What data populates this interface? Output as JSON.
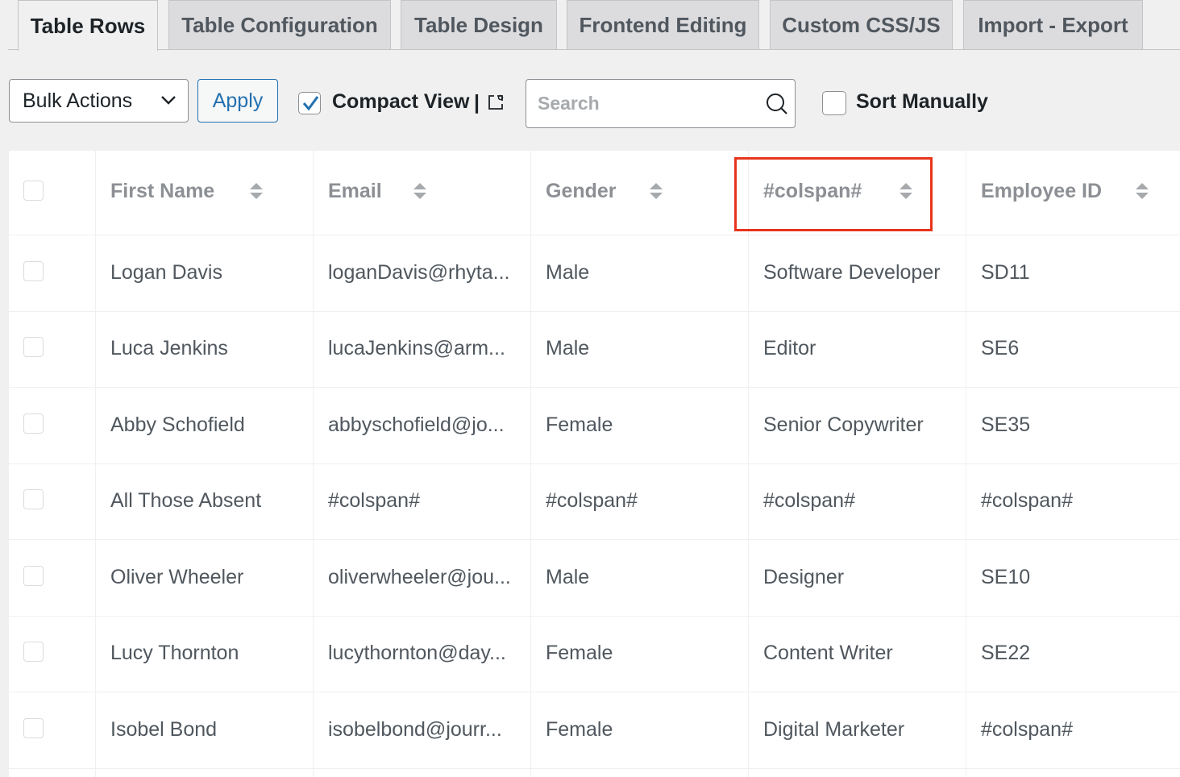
{
  "tabs": [
    {
      "label": "Table Rows",
      "active": true
    },
    {
      "label": "Table Configuration",
      "active": false
    },
    {
      "label": "Table Design",
      "active": false
    },
    {
      "label": "Frontend Editing",
      "active": false
    },
    {
      "label": "Custom CSS/JS",
      "active": false
    },
    {
      "label": "Import - Export",
      "active": false
    }
  ],
  "toolbar": {
    "bulk_actions": "Bulk Actions",
    "apply": "Apply",
    "compact_view": "Compact View",
    "separator": "|",
    "compact_view_checked": true,
    "search_placeholder": "Search",
    "search_value": "",
    "sort_manually": "Sort Manually",
    "sort_manually_checked": false
  },
  "table": {
    "columns": [
      "First Name",
      "Email",
      "Gender",
      "#colspan#",
      "Employee ID"
    ],
    "highlighted_column": "#colspan#",
    "highlight_color": "#e8341c",
    "rows": [
      [
        "Logan Davis",
        "loganDavis@rhyta...",
        "Male",
        "Software Developer",
        "SD11"
      ],
      [
        "Luca Jenkins",
        "lucaJenkins@arm...",
        "Male",
        "Editor",
        "SE6"
      ],
      [
        "Abby Schofield",
        "abbyschofield@jo...",
        "Female",
        "Senior Copywriter",
        "SE35"
      ],
      [
        "All Those Absent",
        "#colspan#",
        "#colspan#",
        "#colspan#",
        "#colspan#"
      ],
      [
        "Oliver Wheeler",
        "oliverwheeler@jou...",
        "Male",
        "Designer",
        "SE10"
      ],
      [
        "Lucy Thornton",
        "lucythornton@day...",
        "Female",
        "Content Writer",
        "SE22"
      ],
      [
        "Isobel Bond",
        "isobelbond@jourr...",
        "Female",
        "Digital Marketer",
        "#colspan#"
      ]
    ]
  },
  "icons": {
    "bulk_chevron": "chevron-down-icon",
    "compact_link": "external-link-icon",
    "search": "search-icon",
    "sort": "sort-arrows-icon",
    "check": "checkmark-icon"
  },
  "colors": {
    "accent": "#2271b1",
    "background": "#f0f0f1",
    "header_text": "#8c8f94",
    "cell_text": "#50575e"
  }
}
